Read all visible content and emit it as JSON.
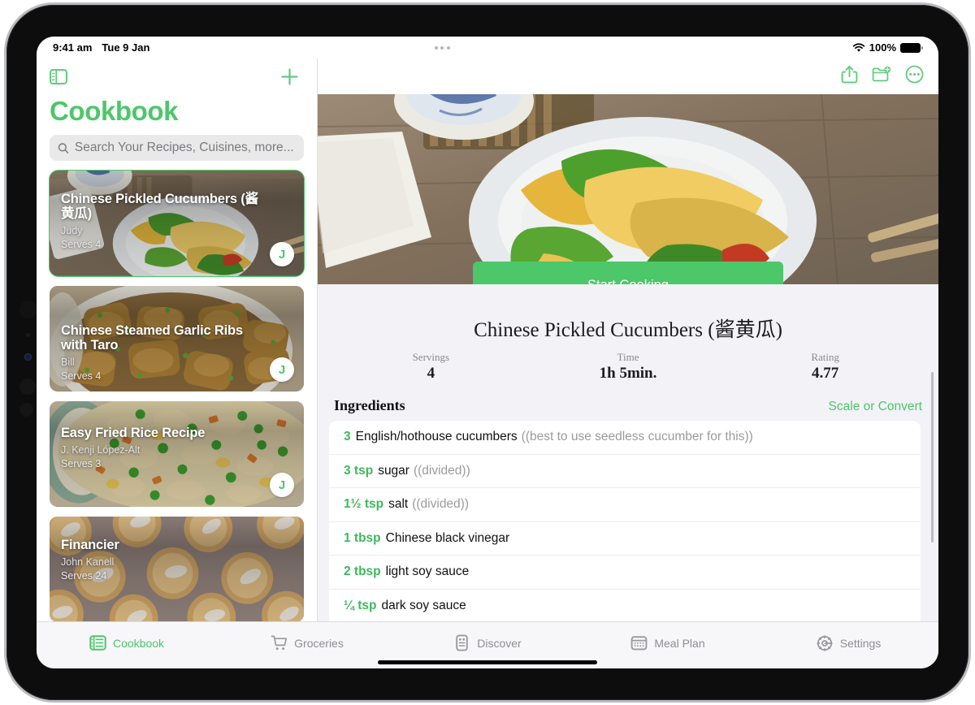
{
  "status_bar": {
    "time": "9:41 am",
    "date": "Tue 9 Jan",
    "battery_text": "100%",
    "wifi_icon": "wifi-icon",
    "battery_icon": "battery-icon",
    "multitask_icon": "multitasking-dots-icon"
  },
  "sidebar": {
    "toggle_icon": "sidebar-toggle-icon",
    "add_icon": "plus-icon",
    "title": "Cookbook",
    "search": {
      "placeholder": "Search Your Recipes, Cuisines, more...",
      "value": "",
      "icon": "search-icon"
    },
    "recipes": [
      {
        "title": "Chinese Pickled Cucumbers (酱黄瓜)",
        "author": "Judy",
        "serves": "Serves 4",
        "avatar": "J",
        "selected": true
      },
      {
        "title": "Chinese Steamed Garlic Ribs with Taro",
        "author": "Bill",
        "serves": "Serves 4",
        "avatar": "J",
        "selected": false
      },
      {
        "title": "Easy Fried Rice Recipe",
        "author": "J. Kenji López-Alt",
        "serves": "Serves 3",
        "avatar": "J",
        "selected": false
      },
      {
        "title": "Financier",
        "author": "John Kanell",
        "serves": "Serves 24",
        "avatar": "",
        "selected": false
      }
    ]
  },
  "detail": {
    "toolbar_icons": [
      "share-icon",
      "folder-add-icon",
      "more-circle-icon"
    ],
    "start_cooking_label": "Start Cooking",
    "recipe_name": "Chinese Pickled Cucumbers (酱黄瓜)",
    "stats": [
      {
        "label": "Servings",
        "value": "4"
      },
      {
        "label": "Time",
        "value": "1h 5min."
      },
      {
        "label": "Rating",
        "value": "4.77"
      }
    ],
    "ingredients_title": "Ingredients",
    "scale_convert_label": "Scale or Convert",
    "ingredients": [
      {
        "qty": "3",
        "name": "English/hothouse cucumbers",
        "note": "((best to use seedless cucumber for this))"
      },
      {
        "qty": "3 tsp",
        "name": "sugar",
        "note": "((divided))"
      },
      {
        "qty": "1½ tsp",
        "name": "salt",
        "note": "((divided))"
      },
      {
        "qty": "1 tbsp",
        "name": "Chinese black vinegar",
        "note": ""
      },
      {
        "qty": "2 tbsp",
        "name": "light soy sauce",
        "note": ""
      },
      {
        "qty": "¼ tsp",
        "name": "dark soy sauce",
        "note": ""
      }
    ]
  },
  "tab_bar": [
    {
      "label": "Cookbook",
      "icon": "cookbook-icon",
      "active": true
    },
    {
      "label": "Groceries",
      "icon": "cart-icon",
      "active": false
    },
    {
      "label": "Discover",
      "icon": "discover-icon",
      "active": false
    },
    {
      "label": "Meal Plan",
      "icon": "calendar-icon",
      "active": false
    },
    {
      "label": "Settings",
      "icon": "gear-icon",
      "active": false
    }
  ],
  "colors": {
    "accent": "#4cc76a",
    "ingredient_qty": "#3cba5c",
    "background": "#f2f2f7",
    "muted_text": "#8e8e93"
  }
}
